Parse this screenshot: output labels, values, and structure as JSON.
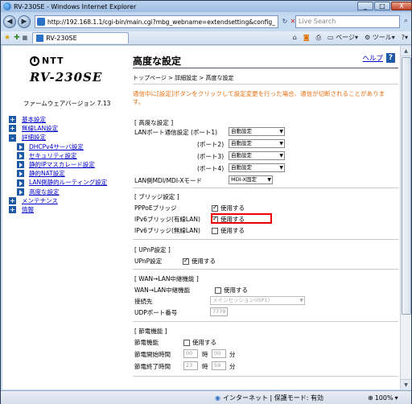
{
  "window": {
    "title": "RV-230SE - Windows Internet Explorer",
    "minimize": "_",
    "maximize": "□",
    "close": "X"
  },
  "address": {
    "url": "http://192.168.1.1/cgi-bin/main.cgi?mbg_webname=extendsetting&config_",
    "search_placeholder": "Live Search"
  },
  "tab": {
    "label": "RV-230SE"
  },
  "toolbar": {
    "page_label": "ページ",
    "tools_label": "ツール",
    "help_label": "?"
  },
  "sidebar": {
    "logo_text": "NTT",
    "model": "RV-230SE",
    "firmware": "ファームウェアバージョン 7.13",
    "items": [
      {
        "icon": "+",
        "label": "基本設定"
      },
      {
        "icon": "+",
        "label": "無線LAN設定"
      },
      {
        "icon": "-",
        "label": "詳細設定"
      }
    ],
    "sub_items": [
      "DHCPv4サーバ設定",
      "セキュリティ設定",
      "静的IPマスカレード設定",
      "静的NAT設定",
      "LAN側静的ルーティング設定",
      "高度な設定"
    ],
    "items2": [
      {
        "icon": "+",
        "label": "メンテナンス"
      },
      {
        "icon": "+",
        "label": "情報"
      }
    ]
  },
  "main": {
    "title": "高度な設定",
    "help": "ヘルプ",
    "help_icon": "?",
    "breadcrumb": "トップページ > 詳細設定 > 高度な設定",
    "notice": "通信中に[設定]ボタンをクリックして設定変更を行った場合、通信が切断されることがあります。",
    "advanced": {
      "heading": "[ 高度な設定 ]",
      "ports": [
        {
          "label": "LANポート通信設定 (ポート1)",
          "value": "自動設定"
        },
        {
          "label": "(ポート2)",
          "value": "自動設定"
        },
        {
          "label": "(ポート3)",
          "value": "自動設定"
        },
        {
          "label": "(ポート4)",
          "value": "自動設定"
        }
      ],
      "mdi_label": "LAN側MDI/MDI-Xモード",
      "mdi_value": "MDI-X固定"
    },
    "bridge": {
      "heading": "[ ブリッジ設定 ]",
      "rows": [
        {
          "label": "PPPoEブリッジ",
          "check": "使用する",
          "checked": true
        },
        {
          "label": "IPv6ブリッジ(有線LAN)",
          "check": "使用する",
          "checked": true
        },
        {
          "label": "IPv6ブリッジ(無線LAN)",
          "check": "使用する",
          "checked": false
        }
      ]
    },
    "upnp": {
      "heading": "[ UPnP設定 ]",
      "label": "UPnP設定",
      "check": "使用する",
      "checked": true
    },
    "relay": {
      "heading": "[ WAN→LAN中継機能 ]",
      "label": "WAN→LAN中継機能",
      "check": "使用する",
      "dest_label": "接続先",
      "dest_value": "メインセッション(ISP1)",
      "udp_label": "UDPポート番号",
      "udp_value": "7779"
    },
    "power": {
      "heading": "[ 節電機能 ]",
      "label": "節電機能",
      "check": "使用する",
      "start_label": "節電開始時間",
      "end_label": "節電終了時間",
      "start_h": "00",
      "start_m": "00",
      "end_h": "23",
      "end_m": "59",
      "hour_unit": "時",
      "min_unit": "分"
    }
  },
  "status": {
    "zone": "インターネット | 保護モード: 有効",
    "zoom": "100%"
  },
  "colors": {
    "accent": "#1f5aa6",
    "notice": "#e86f10",
    "highlight": "#ee0000"
  }
}
